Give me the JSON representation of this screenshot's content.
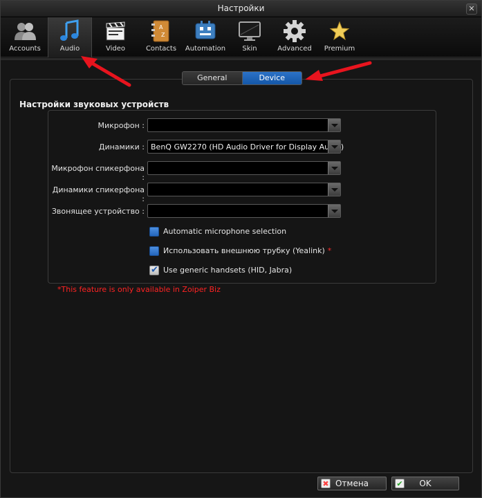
{
  "window": {
    "title": "Настройки",
    "close_glyph": "✕"
  },
  "toolbar": {
    "items": [
      {
        "label": "Accounts",
        "icon": "accounts-icon"
      },
      {
        "label": "Audio",
        "icon": "audio-icon",
        "active": true
      },
      {
        "label": "Video",
        "icon": "video-icon"
      },
      {
        "label": "Contacts",
        "icon": "contacts-icon"
      },
      {
        "label": "Automation",
        "icon": "automation-icon"
      },
      {
        "label": "Skin",
        "icon": "skin-icon"
      },
      {
        "label": "Advanced",
        "icon": "gear-icon"
      },
      {
        "label": "Premium",
        "icon": "star-icon"
      }
    ]
  },
  "tabs": {
    "general": "General",
    "device": "Device",
    "active": "Device"
  },
  "section": {
    "title": "Настройки звуковых устройств"
  },
  "fields": [
    {
      "label": "Микрофон :",
      "value": ""
    },
    {
      "label": "Динамики :",
      "value": "BenQ GW2270 (HD Audio Driver for Display Audio)"
    },
    {
      "label": "Микрофон спикерфона :",
      "value": ""
    },
    {
      "label": "Динамики спикерфона :",
      "value": ""
    },
    {
      "label": "Звонящее устройство :",
      "value": ""
    }
  ],
  "checkboxes": [
    {
      "label": "Automatic microphone selection",
      "checked": false,
      "premium": false
    },
    {
      "label": "Использовать внешнюю трубку (Yealink)",
      "checked": false,
      "premium": true
    },
    {
      "label": "Use generic handsets (HID, Jabra)",
      "checked": true,
      "premium": false
    }
  ],
  "premium_marker": "*",
  "note": "*This feature is only available in Zoiper Biz",
  "buttons": {
    "cancel": "Отмена",
    "cancel_glyph": "✖",
    "ok": "OK",
    "ok_glyph": "✔"
  },
  "colors": {
    "accent": "#1e64b8",
    "annotation_arrow": "#e8141e",
    "note": "#ff2323"
  }
}
